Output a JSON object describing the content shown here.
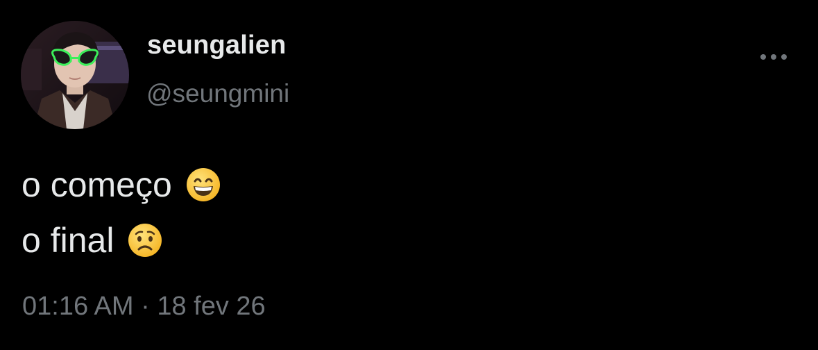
{
  "user": {
    "display_name": "seungalien",
    "handle": "@seungmini",
    "avatar": "profile-photo"
  },
  "more_icon": "more-horizontal-icon",
  "tweet": {
    "lines": [
      {
        "text": "o começo",
        "emoji": "grinning-face-with-smiling-eyes"
      },
      {
        "text": "o final",
        "emoji": "worried-face"
      }
    ]
  },
  "meta": {
    "time": "01:16 AM",
    "separator": "·",
    "date": "18 fev 26"
  },
  "colors": {
    "background": "#000000",
    "primary_text": "#e7e9ea",
    "secondary_text": "#71767b",
    "emoji_yellow": "#ffc83d"
  }
}
